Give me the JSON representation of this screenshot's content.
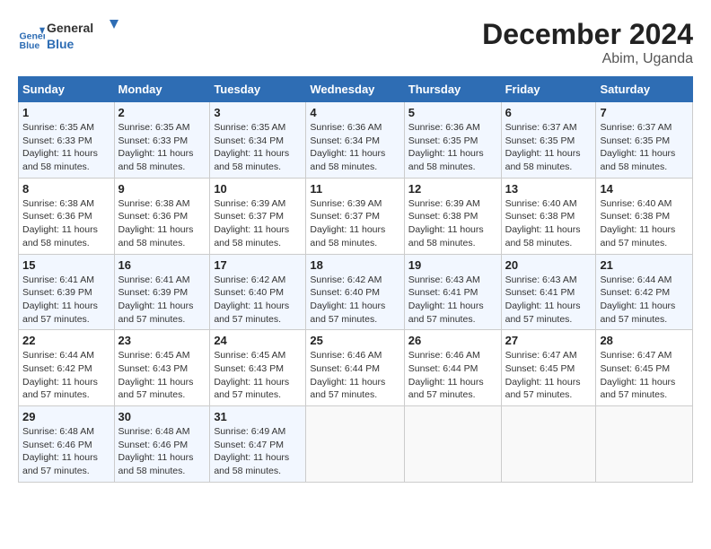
{
  "logo": {
    "line1": "General",
    "line2": "Blue"
  },
  "title": "December 2024",
  "subtitle": "Abim, Uganda",
  "days_of_week": [
    "Sunday",
    "Monday",
    "Tuesday",
    "Wednesday",
    "Thursday",
    "Friday",
    "Saturday"
  ],
  "weeks": [
    [
      {
        "day": 1,
        "sunrise": "6:35 AM",
        "sunset": "6:33 PM",
        "daylight": "11 hours and 58 minutes."
      },
      {
        "day": 2,
        "sunrise": "6:35 AM",
        "sunset": "6:33 PM",
        "daylight": "11 hours and 58 minutes."
      },
      {
        "day": 3,
        "sunrise": "6:35 AM",
        "sunset": "6:34 PM",
        "daylight": "11 hours and 58 minutes."
      },
      {
        "day": 4,
        "sunrise": "6:36 AM",
        "sunset": "6:34 PM",
        "daylight": "11 hours and 58 minutes."
      },
      {
        "day": 5,
        "sunrise": "6:36 AM",
        "sunset": "6:35 PM",
        "daylight": "11 hours and 58 minutes."
      },
      {
        "day": 6,
        "sunrise": "6:37 AM",
        "sunset": "6:35 PM",
        "daylight": "11 hours and 58 minutes."
      },
      {
        "day": 7,
        "sunrise": "6:37 AM",
        "sunset": "6:35 PM",
        "daylight": "11 hours and 58 minutes."
      }
    ],
    [
      {
        "day": 8,
        "sunrise": "6:38 AM",
        "sunset": "6:36 PM",
        "daylight": "11 hours and 58 minutes."
      },
      {
        "day": 9,
        "sunrise": "6:38 AM",
        "sunset": "6:36 PM",
        "daylight": "11 hours and 58 minutes."
      },
      {
        "day": 10,
        "sunrise": "6:39 AM",
        "sunset": "6:37 PM",
        "daylight": "11 hours and 58 minutes."
      },
      {
        "day": 11,
        "sunrise": "6:39 AM",
        "sunset": "6:37 PM",
        "daylight": "11 hours and 58 minutes."
      },
      {
        "day": 12,
        "sunrise": "6:39 AM",
        "sunset": "6:38 PM",
        "daylight": "11 hours and 58 minutes."
      },
      {
        "day": 13,
        "sunrise": "6:40 AM",
        "sunset": "6:38 PM",
        "daylight": "11 hours and 58 minutes."
      },
      {
        "day": 14,
        "sunrise": "6:40 AM",
        "sunset": "6:38 PM",
        "daylight": "11 hours and 57 minutes."
      }
    ],
    [
      {
        "day": 15,
        "sunrise": "6:41 AM",
        "sunset": "6:39 PM",
        "daylight": "11 hours and 57 minutes."
      },
      {
        "day": 16,
        "sunrise": "6:41 AM",
        "sunset": "6:39 PM",
        "daylight": "11 hours and 57 minutes."
      },
      {
        "day": 17,
        "sunrise": "6:42 AM",
        "sunset": "6:40 PM",
        "daylight": "11 hours and 57 minutes."
      },
      {
        "day": 18,
        "sunrise": "6:42 AM",
        "sunset": "6:40 PM",
        "daylight": "11 hours and 57 minutes."
      },
      {
        "day": 19,
        "sunrise": "6:43 AM",
        "sunset": "6:41 PM",
        "daylight": "11 hours and 57 minutes."
      },
      {
        "day": 20,
        "sunrise": "6:43 AM",
        "sunset": "6:41 PM",
        "daylight": "11 hours and 57 minutes."
      },
      {
        "day": 21,
        "sunrise": "6:44 AM",
        "sunset": "6:42 PM",
        "daylight": "11 hours and 57 minutes."
      }
    ],
    [
      {
        "day": 22,
        "sunrise": "6:44 AM",
        "sunset": "6:42 PM",
        "daylight": "11 hours and 57 minutes."
      },
      {
        "day": 23,
        "sunrise": "6:45 AM",
        "sunset": "6:43 PM",
        "daylight": "11 hours and 57 minutes."
      },
      {
        "day": 24,
        "sunrise": "6:45 AM",
        "sunset": "6:43 PM",
        "daylight": "11 hours and 57 minutes."
      },
      {
        "day": 25,
        "sunrise": "6:46 AM",
        "sunset": "6:44 PM",
        "daylight": "11 hours and 57 minutes."
      },
      {
        "day": 26,
        "sunrise": "6:46 AM",
        "sunset": "6:44 PM",
        "daylight": "11 hours and 57 minutes."
      },
      {
        "day": 27,
        "sunrise": "6:47 AM",
        "sunset": "6:45 PM",
        "daylight": "11 hours and 57 minutes."
      },
      {
        "day": 28,
        "sunrise": "6:47 AM",
        "sunset": "6:45 PM",
        "daylight": "11 hours and 57 minutes."
      }
    ],
    [
      {
        "day": 29,
        "sunrise": "6:48 AM",
        "sunset": "6:46 PM",
        "daylight": "11 hours and 57 minutes."
      },
      {
        "day": 30,
        "sunrise": "6:48 AM",
        "sunset": "6:46 PM",
        "daylight": "11 hours and 58 minutes."
      },
      {
        "day": 31,
        "sunrise": "6:49 AM",
        "sunset": "6:47 PM",
        "daylight": "11 hours and 58 minutes."
      },
      null,
      null,
      null,
      null
    ]
  ]
}
